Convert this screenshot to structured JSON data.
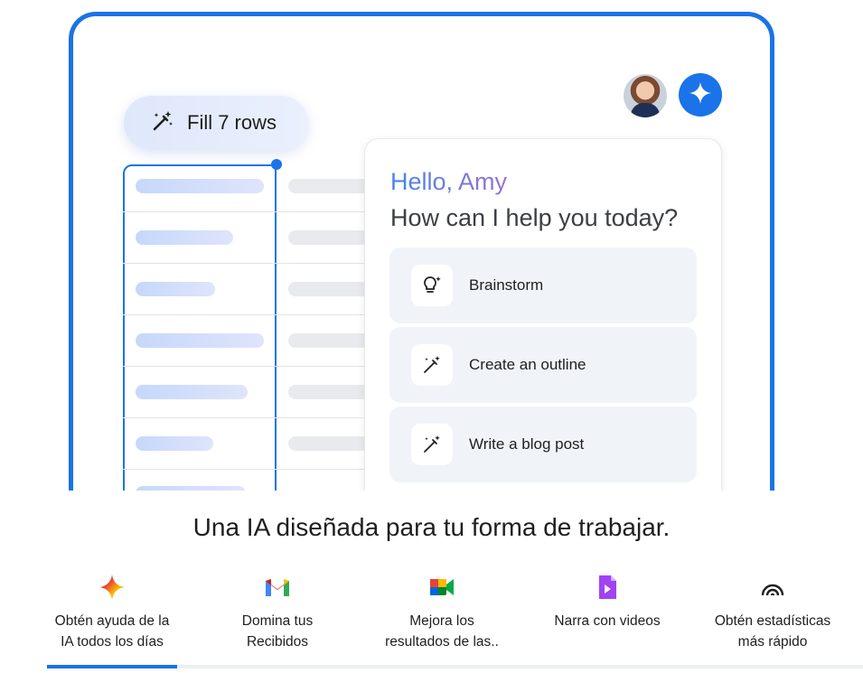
{
  "hero": {
    "fill_chip_label": "Fill 7 rows",
    "chat": {
      "greeting": "Hello, Amy",
      "question": "How can I help you today?",
      "suggestions": [
        {
          "label": "Brainstorm",
          "icon": "lightbulb-sparkle-icon"
        },
        {
          "label": "Create an outline",
          "icon": "magic-wand-icon"
        },
        {
          "label": "Write a blog post",
          "icon": "magic-wand-icon"
        }
      ]
    }
  },
  "headline": "Una IA diseñada para tu forma de trabajar.",
  "features": [
    {
      "line1": "Obtén ayuda de la",
      "line2": "IA todos los días",
      "icon": "gemini-icon"
    },
    {
      "line1": "Domina tus",
      "line2": "Recibidos",
      "icon": "gmail-icon"
    },
    {
      "line1": "Mejora los",
      "line2": "resultados de las..",
      "icon": "meet-icon"
    },
    {
      "line1": "Narra con videos",
      "line2": "",
      "icon": "vids-icon"
    },
    {
      "line1": "Obtén estadísticas",
      "line2": "más rápido",
      "icon": "analytics-icon"
    }
  ],
  "colors": {
    "accent": "#1a73e8"
  }
}
